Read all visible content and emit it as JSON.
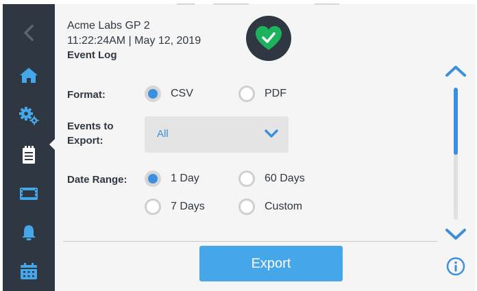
{
  "header": {
    "device_name": "Acme Labs GP 2",
    "datetime": "11:22:24AM | May 12, 2019",
    "page_title": "Event Log"
  },
  "status": {
    "icon": "heart-check-icon",
    "state": "ok",
    "color": "#1db35d"
  },
  "sidebar": {
    "items": [
      {
        "name": "back",
        "icon": "chevron-left-icon"
      },
      {
        "name": "home",
        "icon": "home-icon"
      },
      {
        "name": "settings",
        "icon": "gears-icon"
      },
      {
        "name": "event-log",
        "icon": "clipboard-icon",
        "active": true
      },
      {
        "name": "monitor",
        "icon": "display-icon"
      },
      {
        "name": "alarms",
        "icon": "bell-icon"
      },
      {
        "name": "calendar",
        "icon": "calendar-icon"
      }
    ]
  },
  "form": {
    "format": {
      "label": "Format:",
      "options": [
        "CSV",
        "PDF"
      ],
      "selected": "CSV"
    },
    "events": {
      "label_line1": "Events to",
      "label_line2": "Export:",
      "value": "All"
    },
    "date_range": {
      "label": "Date Range:",
      "options": [
        "1 Day",
        "60 Days",
        "7 Days",
        "Custom"
      ],
      "selected": "1 Day"
    }
  },
  "actions": {
    "export_label": "Export"
  },
  "scroll": {
    "position_fraction": 0.0,
    "visible_fraction": 0.51
  },
  "colors": {
    "sidebar": "#2f3742",
    "accent": "#3a8fdf",
    "button": "#45a6ea",
    "status_ok": "#1db35d"
  }
}
